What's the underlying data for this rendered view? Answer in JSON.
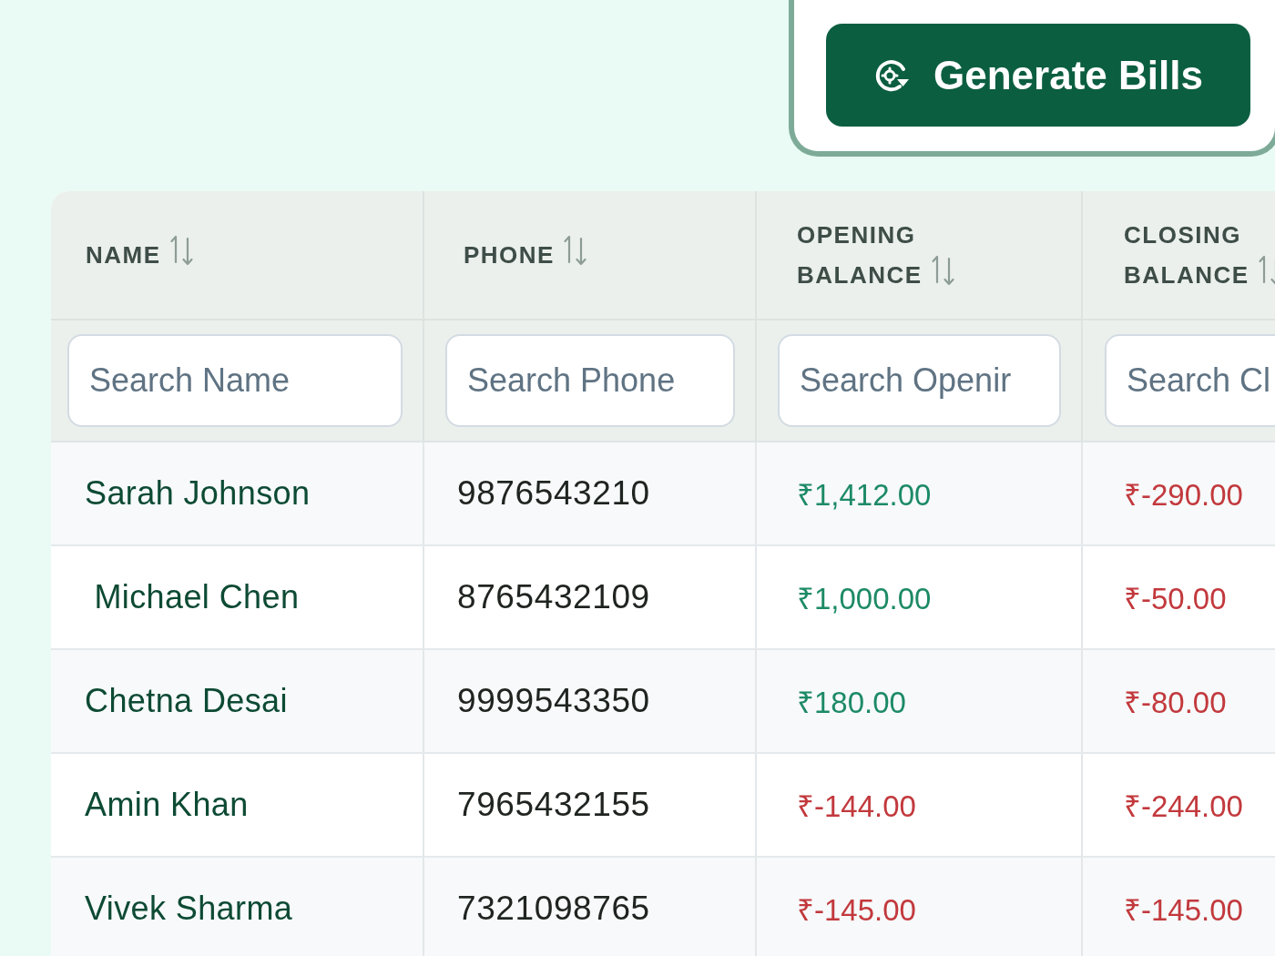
{
  "toolbar": {
    "generate_button": {
      "label": "Generate Bills"
    }
  },
  "table": {
    "columns": [
      {
        "label": "NAME",
        "filter": {
          "placeholder": "Search Name"
        }
      },
      {
        "label": "PHONE",
        "filter": {
          "placeholder": "Search Phone"
        }
      },
      {
        "label": "OPENING BALANCE",
        "filter": {
          "placeholder": "Search Openir"
        }
      },
      {
        "label": "CLOSING BALANCE",
        "filter": {
          "placeholder": "Search Cl"
        }
      }
    ],
    "rows": [
      {
        "name": "Sarah Johnson",
        "phone": "9876543210",
        "opening_balance": {
          "text": "₹1,412.00",
          "color": "#1d8a66"
        },
        "closing_balance": {
          "text": "₹-290.00",
          "color": "#c2393d"
        }
      },
      {
        "name": " Michael Chen",
        "phone": "8765432109",
        "opening_balance": {
          "text": "₹1,000.00",
          "color": "#1d8a66"
        },
        "closing_balance": {
          "text": "₹-50.00",
          "color": "#c2393d"
        }
      },
      {
        "name": "Chetna Desai",
        "phone": "9999543350",
        "opening_balance": {
          "text": "₹180.00",
          "color": "#1d8a66"
        },
        "closing_balance": {
          "text": "₹-80.00",
          "color": "#c2393d"
        }
      },
      {
        "name": "Amin Khan",
        "phone": "7965432155",
        "opening_balance": {
          "text": "₹-144.00",
          "color": "#c2393d"
        },
        "closing_balance": {
          "text": "₹-244.00",
          "color": "#c2393d"
        }
      },
      {
        "name": "Vivek Sharma",
        "phone": "7321098765",
        "opening_balance": {
          "text": "₹-145.00",
          "color": "#c2393d"
        },
        "closing_balance": {
          "text": "₹-145.00",
          "color": "#c2393d"
        }
      }
    ]
  }
}
